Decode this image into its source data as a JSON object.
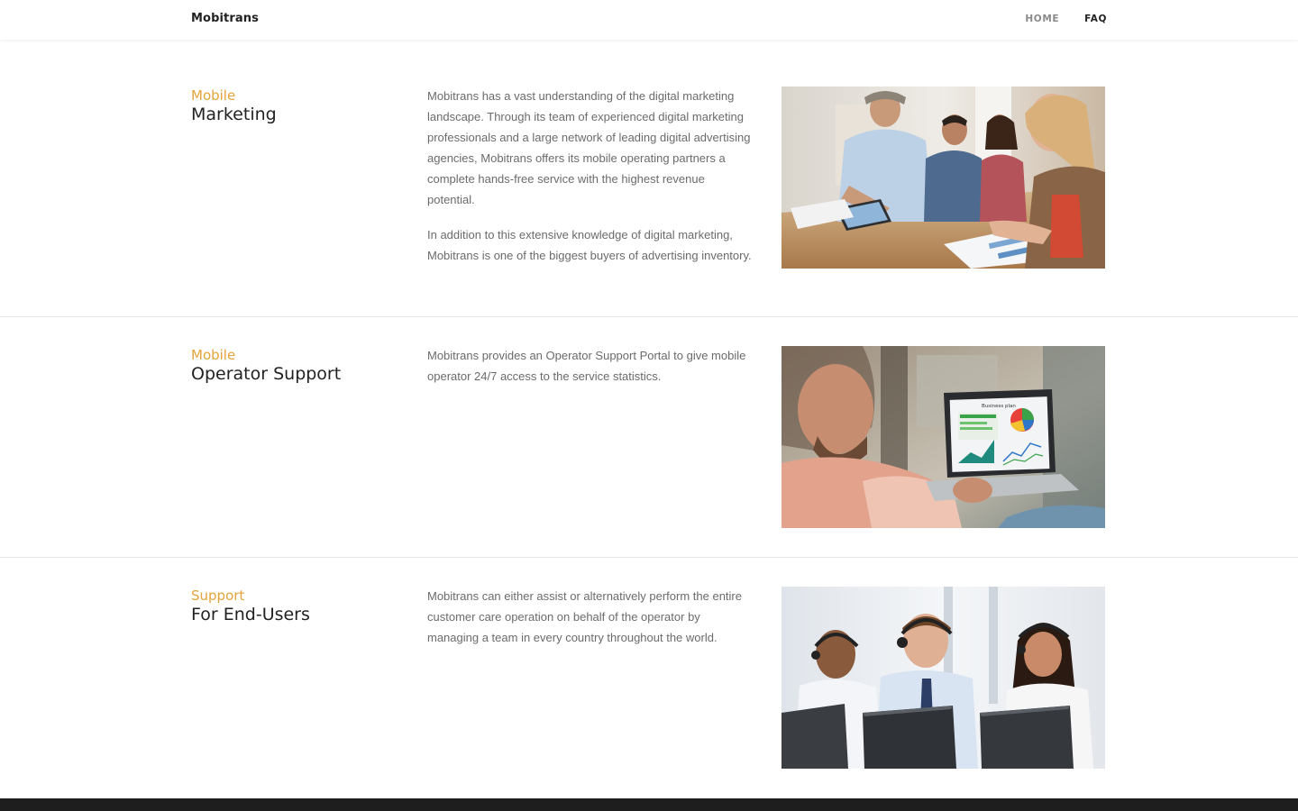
{
  "nav": {
    "brand": "Mobitrans",
    "links": [
      {
        "label": "HOME"
      },
      {
        "label": "FAQ"
      }
    ],
    "active": "FAQ"
  },
  "sections": [
    {
      "kicker": "Mobile",
      "heading": "Marketing",
      "paragraphs": [
        "Mobitrans has a vast understanding of the digital marketing landscape. Through its team of experienced digital marketing professionals and a large network of leading digital advertising agencies, Mobitrans offers its mobile operating partners a complete hands-free service with the highest revenue potential.",
        "In addition to this extensive knowledge of digital marketing, Mobitrans is one of the biggest buyers of advertising inventory."
      ],
      "image_icon": "team-meeting-photo"
    },
    {
      "kicker": "Mobile",
      "heading": "Operator Support",
      "paragraphs": [
        "Mobitrans provides an Operator Support Portal to give mobile operator 24/7 access to the service statistics."
      ],
      "image_icon": "laptop-analytics-photo",
      "laptop_screen_title": "Business plan"
    },
    {
      "kicker": "Support",
      "heading": "For End-Users",
      "paragraphs": [
        "Mobitrans can either assist or alternatively perform the entire customer care operation on behalf of the operator by managing a team in every country throughout the world."
      ],
      "image_icon": "call-center-photo"
    }
  ],
  "colors": {
    "accent": "#e3a33b",
    "heading": "#222222",
    "body_text": "#6b6b6b",
    "footer": "#1e1e1e"
  }
}
